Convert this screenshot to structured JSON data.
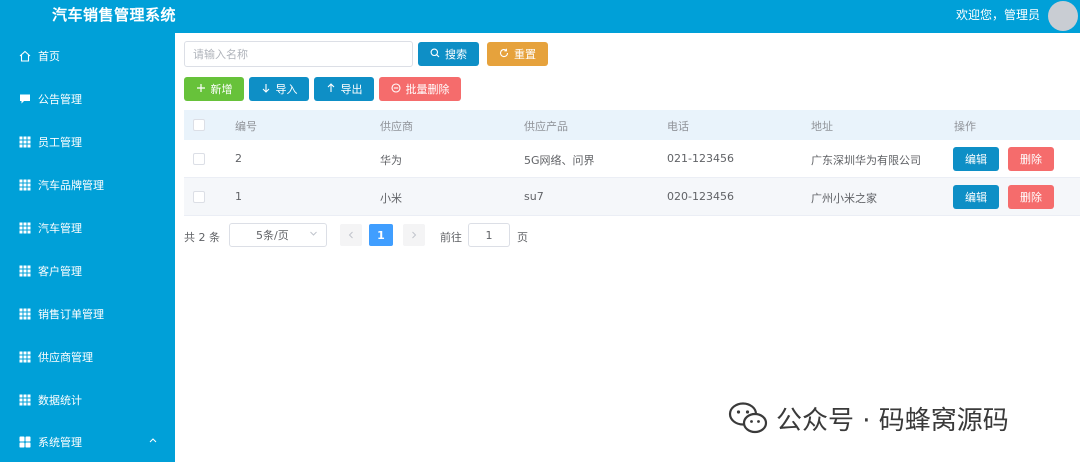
{
  "app": {
    "title": "汽车销售管理系统",
    "welcome": "欢迎您，管理员"
  },
  "sidebar": {
    "items": [
      {
        "label": "首页",
        "icon": "home-icon"
      },
      {
        "label": "公告管理",
        "icon": "chat-icon"
      },
      {
        "label": "员工管理",
        "icon": "grid-icon"
      },
      {
        "label": "汽车品牌管理",
        "icon": "grid-icon"
      },
      {
        "label": "汽车管理",
        "icon": "grid-icon"
      },
      {
        "label": "客户管理",
        "icon": "grid-icon"
      },
      {
        "label": "销售订单管理",
        "icon": "grid-icon"
      },
      {
        "label": "供应商管理",
        "icon": "grid-icon"
      },
      {
        "label": "数据统计",
        "icon": "grid-icon"
      },
      {
        "label": "系统管理",
        "icon": "menu-icon"
      }
    ]
  },
  "search": {
    "placeholder": "请输入名称",
    "value": ""
  },
  "toolbar": {
    "search_label": "搜索",
    "reset_label": "重置",
    "add_label": "新增",
    "import_label": "导入",
    "export_label": "导出",
    "batch_delete_label": "批量删除"
  },
  "table": {
    "headers": [
      "编号",
      "供应商",
      "供应产品",
      "电话",
      "地址",
      "操作"
    ],
    "rows": [
      {
        "id": "2",
        "supplier": "华为",
        "product": "5G网络、问界",
        "phone": "021-123456",
        "address": "广东深圳华为有限公司"
      },
      {
        "id": "1",
        "supplier": "小米",
        "product": "su7",
        "phone": "020-123456",
        "address": "广州小米之家"
      }
    ],
    "edit_label": "编辑",
    "delete_label": "删除"
  },
  "pagination": {
    "total": "共 2 条",
    "page_size": "5条/页",
    "current": "1",
    "goto_label": "前往",
    "goto_value": "1",
    "page_suffix": "页"
  },
  "watermark": {
    "text": "公众号 · 码蜂窝源码"
  },
  "colors": {
    "primary": "#00a0d8",
    "success": "#67c23a",
    "warning": "#e6a23c",
    "danger": "#f56c6c",
    "info_blue": "#0e8fc6",
    "pager_active": "#409eff"
  }
}
